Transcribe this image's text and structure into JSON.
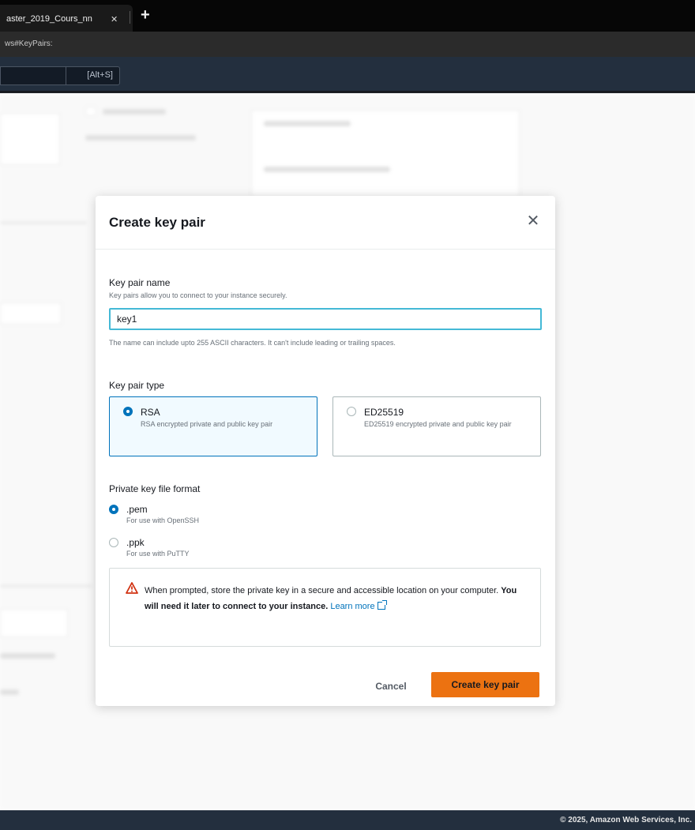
{
  "browser": {
    "tab_title": "aster_2019_Cours_nn",
    "tab_close": "✕",
    "new_tab": "+",
    "url": "ws#KeyPairs:"
  },
  "aws_nav": {
    "search_shortcut": "[Alt+S]"
  },
  "modal": {
    "title": "Create key pair",
    "close": "✕",
    "key_pair_name": {
      "label": "Key pair name",
      "description": "Key pairs allow you to connect to your instance securely.",
      "value": "key1",
      "constraint": "The name can include upto 255 ASCII characters. It can't include leading or trailing spaces."
    },
    "key_pair_type": {
      "label": "Key pair type",
      "options": [
        {
          "title": "RSA",
          "description": "RSA encrypted private and public key pair",
          "selected": true
        },
        {
          "title": "ED25519",
          "description": "ED25519 encrypted private and public key pair",
          "selected": false
        }
      ]
    },
    "private_key_format": {
      "label": "Private key file format",
      "options": [
        {
          "title": ".pem",
          "description": "For use with OpenSSH",
          "selected": true
        },
        {
          "title": ".ppk",
          "description": "For use with PuTTY",
          "selected": false
        }
      ]
    },
    "alert": {
      "text_plain": "When prompted, store the private key in a secure and accessible location on your computer.",
      "text_bold": "You will need it later to connect to your instance.",
      "link": "Learn more"
    },
    "buttons": {
      "cancel": "Cancel",
      "create": "Create key pair"
    }
  },
  "footer": {
    "text": "© 2025, Amazon Web Services, Inc."
  }
}
